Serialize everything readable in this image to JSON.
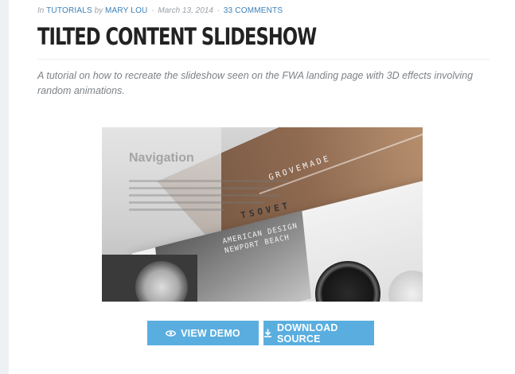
{
  "meta": {
    "in_label": "In",
    "category": "TUTORIALS",
    "by_label": "by",
    "author": "MARY LOU",
    "separator": "·",
    "date": "March 13, 2014",
    "comments": "33 COMMENTS"
  },
  "article": {
    "title": "TILTED CONTENT SLIDESHOW",
    "excerpt": "A tutorial on how to recreate the slideshow seen on the FWA landing page with 3D effects involving random animations."
  },
  "hero": {
    "heading": "Navigation",
    "grovemade": "GROVEMADE",
    "tsovet": "TSOVET",
    "road_caption": "AMERICAN DESIGN\nNEWPORT BEACH"
  },
  "buttons": {
    "view_demo": {
      "label": "VIEW DEMO",
      "icon": "eye-icon"
    },
    "download": {
      "label": "DOWNLOAD SOURCE",
      "icon": "download-icon"
    }
  },
  "colors": {
    "link": "#3a7fb8",
    "button": "#5aaedf",
    "title": "#222222",
    "excerpt": "#7d8287"
  }
}
